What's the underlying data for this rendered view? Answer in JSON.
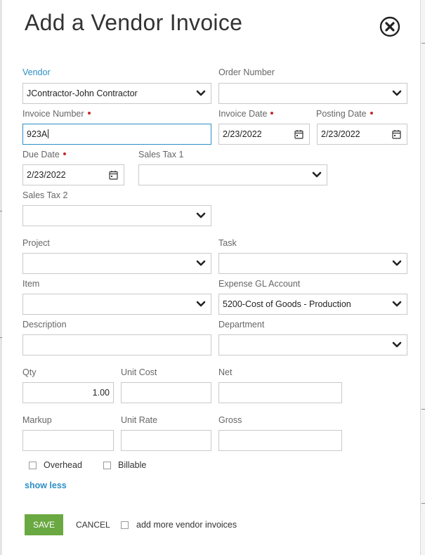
{
  "dialog": {
    "title": "Add a Vendor Invoice",
    "close_icon": "close-circle-icon"
  },
  "fields": {
    "vendor": {
      "label": "Vendor",
      "value": "JContractor-John Contractor"
    },
    "order_number": {
      "label": "Order Number",
      "value": ""
    },
    "invoice_number": {
      "label": "Invoice Number",
      "value": "923A"
    },
    "invoice_date": {
      "label": "Invoice Date",
      "value": "2/23/2022"
    },
    "posting_date": {
      "label": "Posting Date",
      "value": "2/23/2022"
    },
    "due_date": {
      "label": "Due Date",
      "value": "2/23/2022"
    },
    "sales_tax_1": {
      "label": "Sales Tax 1",
      "value": ""
    },
    "sales_tax_2": {
      "label": "Sales Tax 2",
      "value": ""
    },
    "project": {
      "label": "Project",
      "value": ""
    },
    "task": {
      "label": "Task",
      "value": ""
    },
    "item": {
      "label": "Item",
      "value": ""
    },
    "expense_gl_account": {
      "label": "Expense GL Account",
      "value": "5200-Cost of Goods - Production"
    },
    "description": {
      "label": "Description",
      "value": ""
    },
    "department": {
      "label": "Department",
      "value": ""
    },
    "qty": {
      "label": "Qty",
      "value": "1.00"
    },
    "unit_cost": {
      "label": "Unit Cost",
      "value": ""
    },
    "net": {
      "label": "Net",
      "value": ""
    },
    "markup": {
      "label": "Markup",
      "value": ""
    },
    "unit_rate": {
      "label": "Unit Rate",
      "value": ""
    },
    "gross": {
      "label": "Gross",
      "value": ""
    }
  },
  "checkboxes": {
    "overhead": {
      "label": "Overhead",
      "checked": false
    },
    "billable": {
      "label": "Billable",
      "checked": false
    },
    "add_more": {
      "label": "add more vendor invoices",
      "checked": false
    }
  },
  "links": {
    "show_less": "show less"
  },
  "actions": {
    "save": "SAVE",
    "cancel": "CANCEL"
  },
  "colors": {
    "accent": "#2c8fc6",
    "save_bg": "#6aa842",
    "required": "#c62828"
  }
}
